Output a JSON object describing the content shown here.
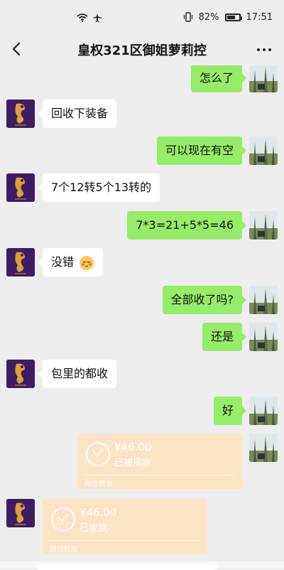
{
  "status": {
    "battery": "82%",
    "time": "17:51",
    "battery_level": 0.82
  },
  "header": {
    "title": "皇权321区御姐萝莉控"
  },
  "messages": [
    {
      "side": "right",
      "text": "怎么了"
    },
    {
      "side": "left",
      "text": "回收下装备"
    },
    {
      "side": "right",
      "text": "可以现在有空"
    },
    {
      "side": "left",
      "text": "7个12转5个13转的"
    },
    {
      "side": "right",
      "text": "7*3=21+5*5=46"
    },
    {
      "side": "left",
      "text": "没错"
    },
    {
      "side": "right",
      "text": "全部收了吗?"
    },
    {
      "side": "right",
      "text": "还是"
    },
    {
      "side": "left",
      "text": "包里的都收"
    },
    {
      "side": "right",
      "text": "好"
    }
  ],
  "transfers": [
    {
      "side": "right",
      "amount": "¥46.00",
      "status": "已被接收",
      "caption": "微信转账"
    },
    {
      "side": "left",
      "amount": "¥46.00",
      "status": "已收款",
      "caption": "微信转账"
    }
  ],
  "colors": {
    "background": "#ededed",
    "bubble_self": "#95ec69",
    "bubble_other": "#ffffff",
    "transfer": "#fbe3c6"
  }
}
